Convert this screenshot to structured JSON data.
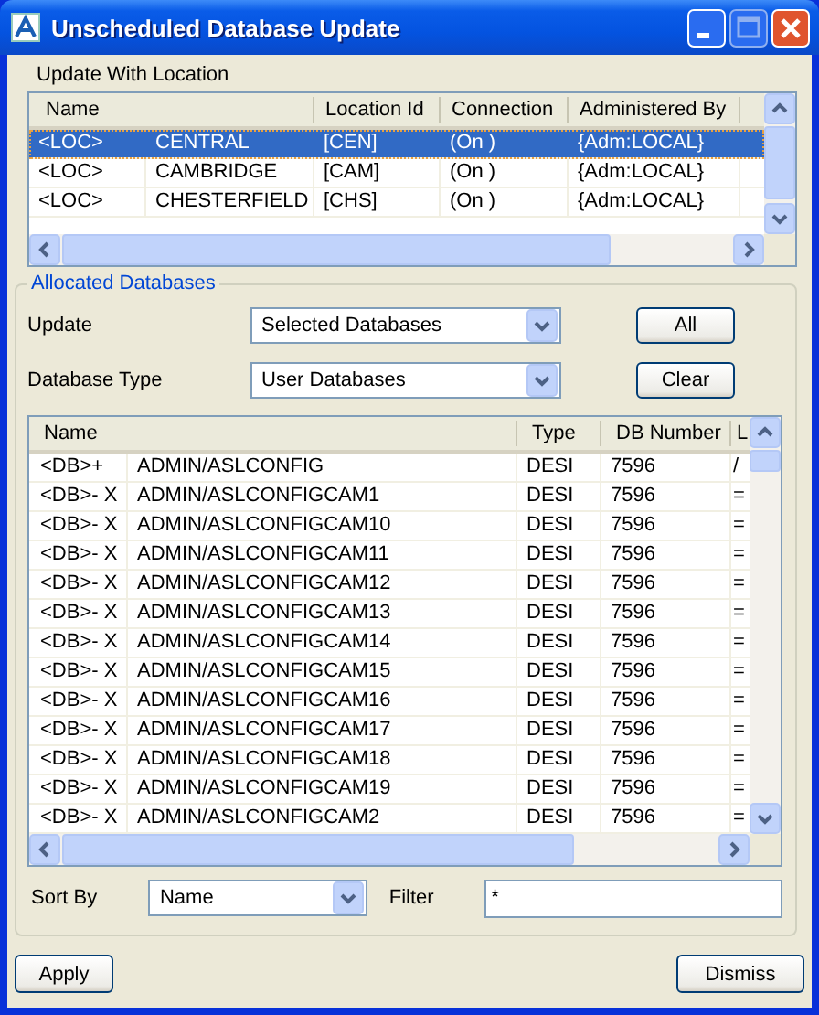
{
  "window": {
    "title": "Unscheduled Database Update"
  },
  "location_list": {
    "label": "Update With Location",
    "columns": [
      "Name",
      "Location Id",
      "Connection",
      "Administered By"
    ],
    "rows": [
      {
        "tag": "<LOC>",
        "name": "CENTRAL",
        "location_id": "[CEN]",
        "connection": "(On )",
        "administered_by": "{Adm:LOCAL}",
        "selected": true
      },
      {
        "tag": "<LOC>",
        "name": "CAMBRIDGE",
        "location_id": "[CAM]",
        "connection": "(On )",
        "administered_by": "{Adm:LOCAL}",
        "selected": false
      },
      {
        "tag": "<LOC>",
        "name": "CHESTERFIELD",
        "location_id": "[CHS]",
        "connection": "(On )",
        "administered_by": "{Adm:LOCAL}",
        "selected": false
      }
    ]
  },
  "allocated": {
    "title": "Allocated Databases",
    "update": {
      "label": "Update",
      "value": "Selected Databases"
    },
    "database_type": {
      "label": "Database Type",
      "value": "User Databases"
    },
    "buttons": [
      "All",
      "Clear"
    ],
    "database_list": {
      "columns": [
        "Name",
        "Type",
        "DB Number",
        "L"
      ],
      "rows": [
        {
          "flag": "<DB>+",
          "name": "ADMIN/ASLCONFIG",
          "type": "DESI",
          "db_number": "7596",
          "column_4": "/",
          "selected": false
        },
        {
          "flag": "<DB>- X",
          "name": "ADMIN/ASLCONFIGCAM1",
          "type": "DESI",
          "db_number": "7596",
          "column_4": "=",
          "selected": false
        },
        {
          "flag": "<DB>- X",
          "name": "ADMIN/ASLCONFIGCAM10",
          "type": "DESI",
          "db_number": "7596",
          "column_4": "=",
          "selected": false
        },
        {
          "flag": "<DB>- X",
          "name": "ADMIN/ASLCONFIGCAM11",
          "type": "DESI",
          "db_number": "7596",
          "column_4": "=",
          "selected": false
        },
        {
          "flag": "<DB>- X",
          "name": "ADMIN/ASLCONFIGCAM12",
          "type": "DESI",
          "db_number": "7596",
          "column_4": "=",
          "selected": false
        },
        {
          "flag": "<DB>- X",
          "name": "ADMIN/ASLCONFIGCAM13",
          "type": "DESI",
          "db_number": "7596",
          "column_4": "=",
          "selected": false
        },
        {
          "flag": "<DB>- X",
          "name": "ADMIN/ASLCONFIGCAM14",
          "type": "DESI",
          "db_number": "7596",
          "column_4": "=",
          "selected": false
        },
        {
          "flag": "<DB>- X",
          "name": "ADMIN/ASLCONFIGCAM15",
          "type": "DESI",
          "db_number": "7596",
          "column_4": "=",
          "selected": false
        },
        {
          "flag": "<DB>- X",
          "name": "ADMIN/ASLCONFIGCAM16",
          "type": "DESI",
          "db_number": "7596",
          "column_4": "=",
          "selected": false
        },
        {
          "flag": "<DB>- X",
          "name": "ADMIN/ASLCONFIGCAM17",
          "type": "DESI",
          "db_number": "7596",
          "column_4": "=",
          "selected": false
        },
        {
          "flag": "<DB>- X",
          "name": "ADMIN/ASLCONFIGCAM18",
          "type": "DESI",
          "db_number": "7596",
          "column_4": "=",
          "selected": false
        },
        {
          "flag": "<DB>- X",
          "name": "ADMIN/ASLCONFIGCAM19",
          "type": "DESI",
          "db_number": "7596",
          "column_4": "=",
          "selected": false
        },
        {
          "flag": "<DB>- X",
          "name": "ADMIN/ASLCONFIGCAM2",
          "type": "DESI",
          "db_number": "7596",
          "column_4": "=",
          "selected": false
        }
      ]
    },
    "sort_by": {
      "label": "Sort By",
      "value": "Name"
    },
    "filter": {
      "label": "Filter",
      "value": "*"
    }
  },
  "buttons": [
    "Apply",
    "Dismiss"
  ]
}
